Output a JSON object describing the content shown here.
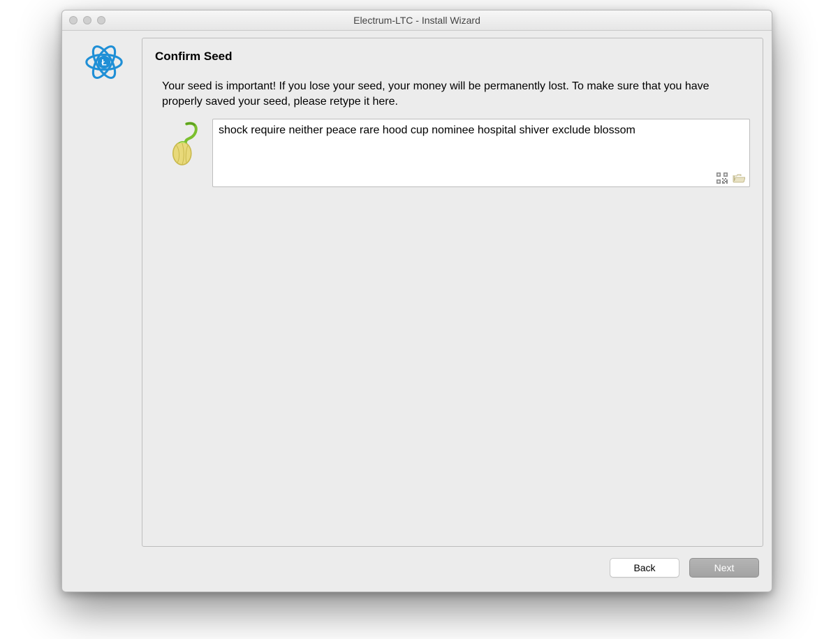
{
  "window": {
    "title": "Electrum-LTC  -  Install Wizard"
  },
  "panel": {
    "heading": "Confirm Seed",
    "instructions": "Your seed is important! If you lose your seed, your money will be permanently lost. To make sure that you have properly saved your seed, please retype it here.",
    "seed_value": "shock require neither peace rare hood cup nominee hospital shiver exclude blossom"
  },
  "footer": {
    "back_label": "Back",
    "next_label": "Next"
  },
  "icons": {
    "app_logo": "electrum-ltc-logo",
    "seed": "seed-sprout-icon",
    "qr": "qr-code-icon",
    "folder": "folder-open-icon"
  }
}
